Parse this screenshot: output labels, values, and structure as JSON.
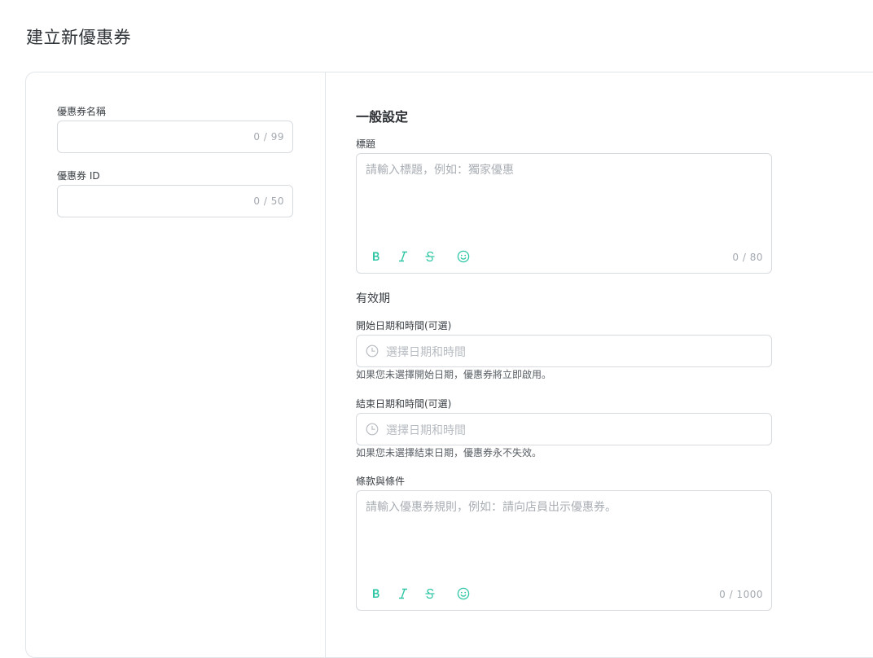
{
  "page": {
    "title": "建立新優惠券"
  },
  "left": {
    "name_field": {
      "label": "優惠券名稱",
      "value": "",
      "counter": "0 / 99"
    },
    "id_field": {
      "label": "優惠券 ID",
      "value": "",
      "counter": "0 / 50"
    }
  },
  "general": {
    "section_title": "一般設定",
    "title_field": {
      "label": "標題",
      "placeholder": "請輸入標題，例如：獨家優惠",
      "counter": "0 / 80"
    },
    "validity": {
      "title": "有效期",
      "start": {
        "label": "開始日期和時間(可選)",
        "placeholder": "選擇日期和時間",
        "help": "如果您未選擇開始日期，優惠券將立即啟用。"
      },
      "end": {
        "label": "結束日期和時間(可選)",
        "placeholder": "選擇日期和時間",
        "help": "如果您未選擇結束日期，優惠券永不失效。"
      }
    },
    "terms_field": {
      "label": "條款與條件",
      "placeholder": "請輸入優惠券規則，例如：請向店員出示優惠券。",
      "counter": "0 / 1000"
    }
  },
  "icons": {
    "bold": "bold-icon",
    "italic": "italic-icon",
    "strike": "strikethrough-icon",
    "emoji": "emoji-icon",
    "clock": "clock-icon"
  },
  "colors": {
    "accent": "#2fc6a5",
    "border": "#d7dbdf"
  }
}
